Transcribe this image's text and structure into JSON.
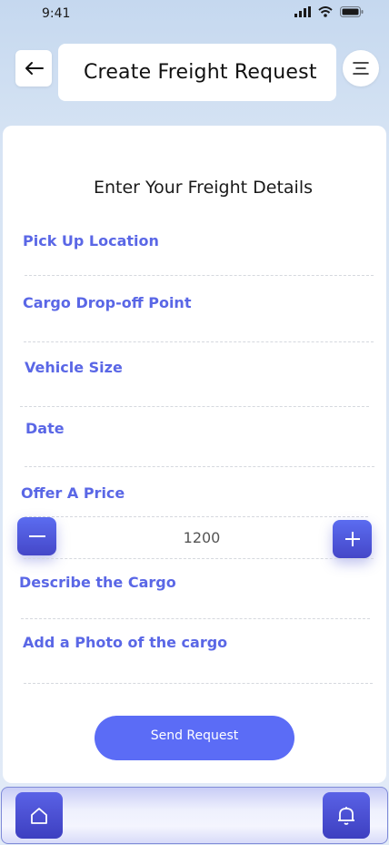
{
  "status_bar": {
    "time": "9:41"
  },
  "header": {
    "title": "Create Freight Request"
  },
  "form": {
    "heading": "Enter Your Freight Details",
    "pickup_label": "Pick Up Location",
    "dropoff_label": "Cargo Drop-off Point",
    "vehicle_label": "Vehicle Size",
    "date_label": "Date",
    "price_label": "Offer A Price",
    "price_value": "1200",
    "describe_label": "Describe the Cargo",
    "photo_label": "Add a Photo of the cargo",
    "submit_label": "Send Request"
  },
  "icons": {
    "back": "arrow-left-icon",
    "menu": "menu-icon",
    "minus": "minus-icon",
    "plus": "plus-icon",
    "home": "home-icon",
    "bell": "bell-icon"
  },
  "colors": {
    "accent": "#5a67e6",
    "button": "#5b6cf6"
  }
}
